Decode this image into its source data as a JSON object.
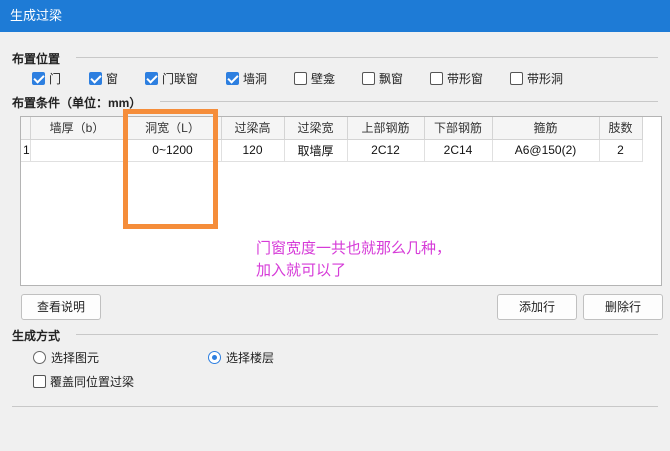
{
  "window": {
    "title": "生成过梁"
  },
  "placement": {
    "header": "布置位置",
    "options": [
      {
        "label": "门",
        "checked": true
      },
      {
        "label": "窗",
        "checked": true
      },
      {
        "label": "门联窗",
        "checked": true
      },
      {
        "label": "墙洞",
        "checked": true
      },
      {
        "label": "壁龛",
        "checked": false
      },
      {
        "label": "飘窗",
        "checked": false
      },
      {
        "label": "带形窗",
        "checked": false
      },
      {
        "label": "带形洞",
        "checked": false
      }
    ]
  },
  "conditions": {
    "header": "布置条件（单位：mm）",
    "columns": [
      "墙厚（b）",
      "洞宽（L）",
      "过梁高",
      "过梁宽",
      "上部钢筋",
      "下部钢筋",
      "箍筋",
      "肢数"
    ],
    "rows": [
      {
        "index": "1",
        "cells": [
          "",
          "0~1200",
          "120",
          "取墙厚",
          "2C12",
          "2C14",
          "A6@150(2)",
          "2"
        ]
      }
    ]
  },
  "buttons": {
    "view_help": "查看说明",
    "add_row": "添加行",
    "delete_row": "删除行"
  },
  "generation": {
    "header": "生成方式",
    "radios": [
      {
        "label": "选择图元",
        "selected": false
      },
      {
        "label": "选择楼层",
        "selected": true
      }
    ],
    "overwrite": {
      "label": "覆盖同位置过梁",
      "checked": false
    }
  },
  "annotation": {
    "line1": "门窗宽度一共也就那么几种，",
    "line2": "加入就可以了"
  },
  "colors": {
    "titlebar": "#1e7bd6",
    "accent": "#2d7fe0",
    "highlight": "#f58d3a",
    "note": "#d63bd8"
  }
}
